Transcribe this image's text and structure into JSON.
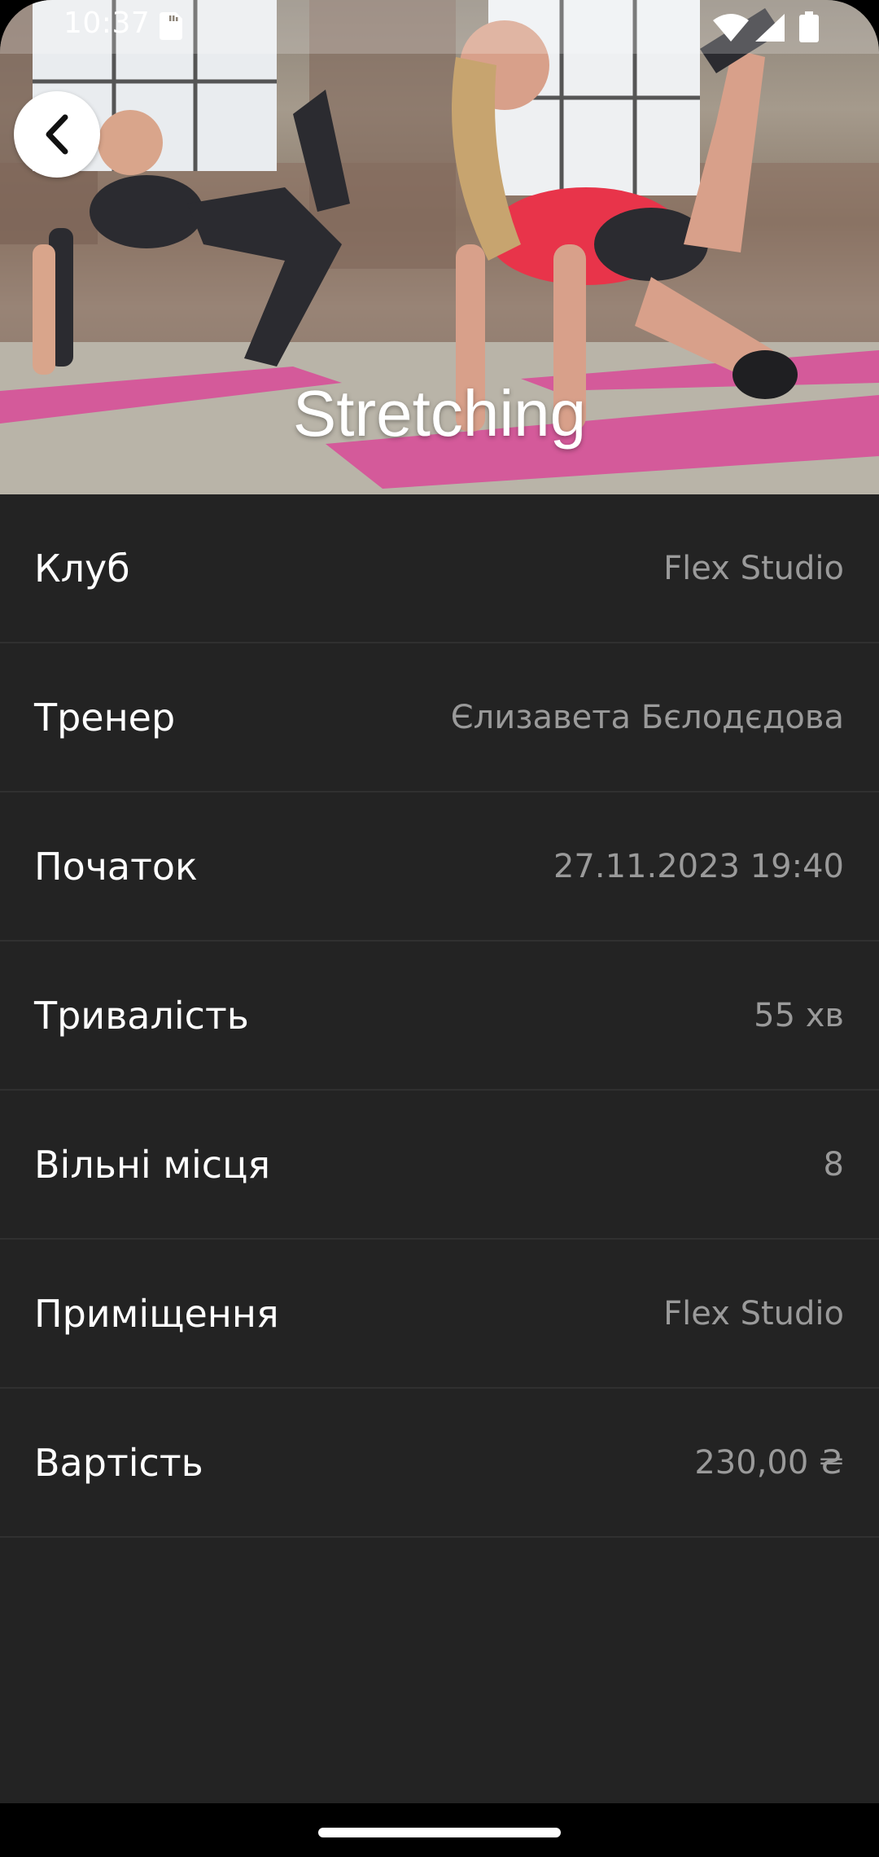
{
  "status_bar": {
    "time": "10:37",
    "icons": [
      "sd-card-icon",
      "wifi-icon",
      "signal-icon",
      "battery-icon"
    ]
  },
  "header": {
    "title": "Stretching",
    "back_icon": "chevron-left-icon"
  },
  "details": [
    {
      "label": "Клуб",
      "value": "Flex Studio"
    },
    {
      "label": "Тренер",
      "value": "Єлизавета Бєлодєдова"
    },
    {
      "label": "Початок",
      "value": "27.11.2023 19:40"
    },
    {
      "label": "Тривалість",
      "value": "55 хв"
    },
    {
      "label": "Вільні місця",
      "value": "8"
    },
    {
      "label": "Приміщення",
      "value": "Flex Studio"
    },
    {
      "label": "Вартість",
      "value": "230,00 ₴"
    }
  ],
  "colors": {
    "background": "#232323",
    "label": "#ffffff",
    "value": "#9a9a9a",
    "divider": "#303030",
    "accent_mat": "#d45a9a"
  }
}
